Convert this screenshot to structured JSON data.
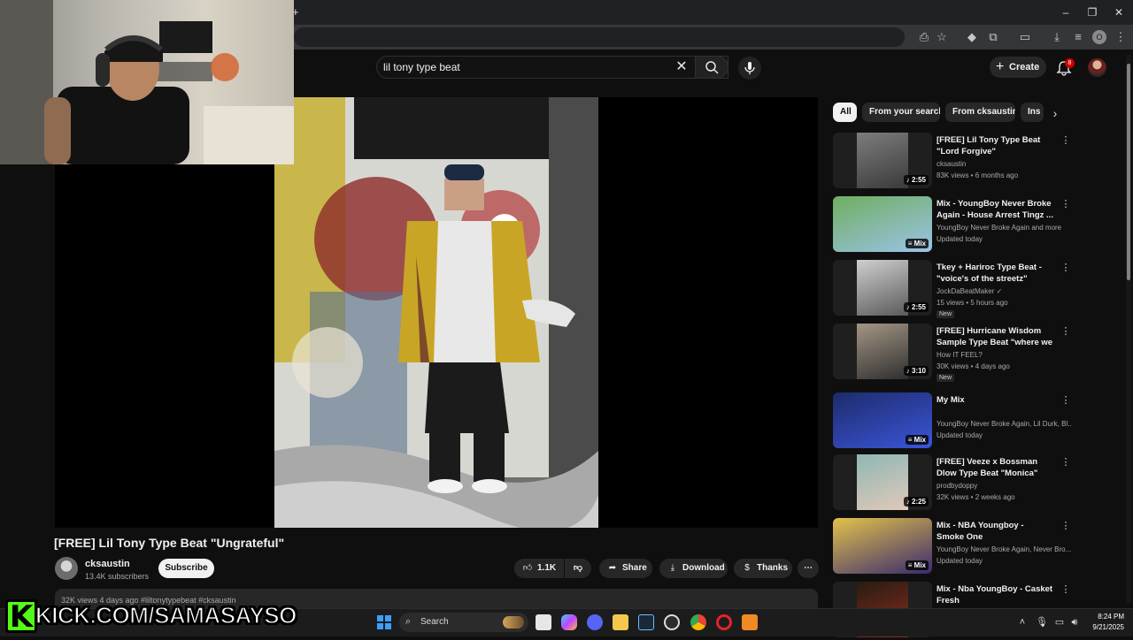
{
  "browser": {
    "new_tab": "+",
    "window_controls": {
      "minimize": "–",
      "restore": "❐",
      "close": "✕"
    },
    "toolbar_icons": [
      "install-icon",
      "star-icon",
      "extension-diamond-icon",
      "puzzle-icon",
      "split-view-icon",
      "download-icon",
      "reading-list-icon",
      "profile-icon",
      "menu-icon"
    ],
    "profile_initial": "O"
  },
  "youtube": {
    "search": {
      "value": "lil tony type beat",
      "clear": "✕"
    },
    "create_label": "Create",
    "create_plus": "+",
    "notifications_count": "8"
  },
  "video": {
    "title": "[FREE] Lil Tony Type Beat \"Ungrateful\"",
    "channel": "cksaustin",
    "subscribers": "13.4K subscribers",
    "subscribe_label": "Subscribe",
    "likes": "1.1K",
    "share_label": "Share",
    "download_label": "Download",
    "thanks_label": "Thanks",
    "more": "⋯",
    "description_line": "32K views  4 days ago  #liltonytypebeat #cksaustin"
  },
  "chips": [
    {
      "label": "All",
      "active": true
    },
    {
      "label": "From your search",
      "active": false
    },
    {
      "label": "From cksaustin",
      "active": false
    },
    {
      "label": "Ins",
      "active": false
    }
  ],
  "recommendations": [
    {
      "title": "[FREE] Lil Tony Type Beat \"Lord Forgive\"",
      "channel": "cksaustin",
      "meta": "83K views • 6 months ago",
      "badge": "♪ 2:55",
      "new": "",
      "colors": [
        "#7d7d7d",
        "#3a3a3a"
      ]
    },
    {
      "title": "Mix - YoungBoy Never Broke Again - House Arrest Tingz ...",
      "channel": "YoungBoy Never Broke Again and more",
      "meta": "Updated today",
      "badge": "≡ Mix",
      "new": "",
      "colors": [
        "#6fae5f",
        "#9bc3e8"
      ]
    },
    {
      "title": "Tkey + Hariroc Type Beat - \"voice's of the streetz\"",
      "channel": "JockDaBeatMaker ✓",
      "meta": "15 views • 5 hours ago",
      "badge": "♪ 2:55",
      "new": "New",
      "colors": [
        "#cfcfcf",
        "#5a5a5a"
      ]
    },
    {
      "title": "[FREE] Hurricane Wisdom Sample Type Beat \"where we ...",
      "channel": "How IT FEEL?",
      "meta": "30K views • 4 days ago",
      "badge": "♪ 3:10",
      "new": "New",
      "colors": [
        "#a49685",
        "#2f2f2f"
      ]
    },
    {
      "title": "My Mix",
      "channel": "YoungBoy Never Broke Again, Lil Durk, Bl...",
      "meta": "Updated today",
      "badge": "≡ Mix",
      "new": "",
      "colors": [
        "#1d2b6b",
        "#3b55d9"
      ]
    },
    {
      "title": "[FREE] Veeze x Bossman Dlow Type Beat \"Monica\"",
      "channel": "prodbydoppy",
      "meta": "32K views • 2 weeks ago",
      "badge": "♪ 2:25",
      "new": "",
      "colors": [
        "#8fb7b5",
        "#e0c9b9"
      ]
    },
    {
      "title": "Mix - NBA Youngboy - Smoke One",
      "channel": "YoungBoy Never Broke Again, Never Bro...",
      "meta": "Updated today",
      "badge": "≡ Mix",
      "new": "",
      "colors": [
        "#e3c24a",
        "#3a2a6e"
      ]
    },
    {
      "title": "Mix - Nba YoungBoy - Casket Fresh",
      "channel": "",
      "meta": "",
      "badge": "",
      "new": "",
      "colors": [
        "#2a1b12",
        "#8a2f1e"
      ]
    }
  ],
  "taskbar": {
    "search_label": "Search",
    "time": "8:24 PM",
    "date": "9/21/2025"
  },
  "watermark": {
    "logo_letter": "K",
    "text": "KICK.COM/SAMASAYSO"
  },
  "colors": {
    "background": "#0f0f0f",
    "chip_bg": "#272727",
    "kick_green": "#53fc18",
    "badge_red": "#cc0000"
  }
}
